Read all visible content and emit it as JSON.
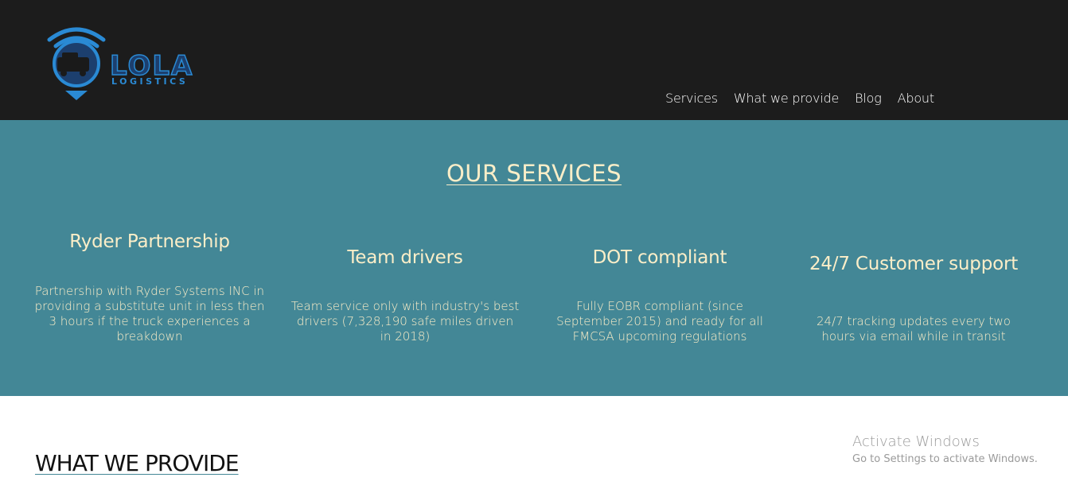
{
  "brand": {
    "logo_word": "LOLA",
    "logo_sub": "LOGISTICS",
    "accent": "#2a8ad4"
  },
  "nav": {
    "items": [
      "Services",
      "What we provide",
      "Blog",
      "About"
    ]
  },
  "services": {
    "title": "OUR SERVICES",
    "background": "#438796",
    "text_color": "#fbeec8",
    "items": [
      {
        "title": "Ryder Partnership",
        "text": "Partnership with Ryder Systems INC in providing a substitute unit in less then 3 hours if the truck experiences a breakdown"
      },
      {
        "title": "Team drivers",
        "text": "Team service only with industry's best drivers (7,328,190 safe miles driven in 2018)"
      },
      {
        "title": "DOT compliant",
        "text": "Fully EOBR compliant (since September 2015) and ready for all FMCSA upcoming regulations"
      },
      {
        "title": "24/7 Customer support",
        "text": "24/7 tracking updates every two hours via email while in transit"
      }
    ]
  },
  "provide": {
    "title": "WHAT WE PROVIDE"
  },
  "watermark": {
    "title": "Activate Windows",
    "subtitle": "Go to Settings to activate Windows."
  }
}
